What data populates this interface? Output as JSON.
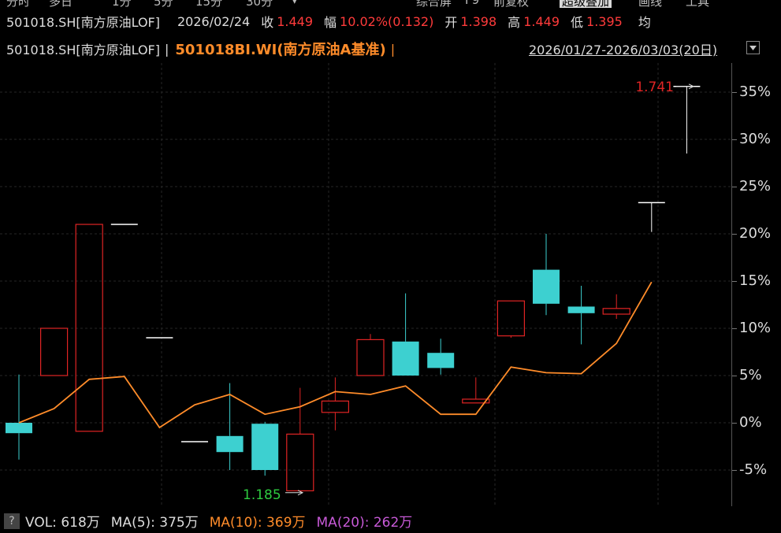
{
  "toolbar": {
    "items": [
      "分时",
      "多日",
      "1分",
      "5分",
      "15分",
      "30分",
      "▾"
    ],
    "right_items": [
      "综合屏",
      "F9",
      "前复权",
      "超级叠加",
      "画线",
      "工具"
    ]
  },
  "quote": {
    "symbol": "501018.SH[南方原油LOF]",
    "date": "2026/02/24",
    "close_label": "收",
    "close_value": "1.449",
    "change_label": "幅",
    "change_value": "10.02%(0.132)",
    "open_label": "开",
    "open_value": "1.398",
    "high_label": "高",
    "high_value": "1.449",
    "low_label": "低",
    "low_value": "1.395",
    "avg_label": "均"
  },
  "overlay": {
    "primary": "501018.SH[南方原油LOF]",
    "separator1": "|",
    "benchmark": "501018BI.WI(南方原油A基准)",
    "separator2": "|",
    "range": "2026/01/27-2026/03/03(20日)"
  },
  "chart_data": {
    "type": "candlestick",
    "y_axis": {
      "unit": "%",
      "ticks": [
        "35%",
        "30%",
        "25%",
        "20%",
        "15%",
        "10%",
        "5%",
        "0%",
        "-5%"
      ],
      "ylim": [
        -9,
        38
      ]
    },
    "annotations": {
      "max_label": "1.741",
      "min_label": "1.185"
    },
    "candles": [
      {
        "o": 0,
        "c": -1.1,
        "h": 5.1,
        "l": -3.9,
        "dir": "down"
      },
      {
        "o": 5.0,
        "c": 10.0,
        "h": 10.0,
        "l": 5.0,
        "dir": "up"
      },
      {
        "o": -0.9,
        "c": 21.0,
        "h": 21.0,
        "l": -0.9,
        "dir": "up"
      },
      {
        "o": 21.0,
        "c": 21.0,
        "h": 21.0,
        "l": 21.0,
        "dir": "flat"
      },
      {
        "o": 9.0,
        "c": 9.0,
        "h": 9.0,
        "l": 9.0,
        "dir": "flat"
      },
      {
        "o": -2.0,
        "c": -2.0,
        "h": -2.0,
        "l": -2.0,
        "dir": "flat"
      },
      {
        "o": -1.4,
        "c": -3.1,
        "h": 4.2,
        "l": -5.0,
        "dir": "down"
      },
      {
        "o": -0.1,
        "c": -5.0,
        "h": 0.1,
        "l": -5.6,
        "dir": "down"
      },
      {
        "o": -7.2,
        "c": -1.2,
        "h": 3.7,
        "l": -7.2,
        "dir": "up"
      },
      {
        "o": 1.1,
        "c": 2.3,
        "h": 4.8,
        "l": -0.8,
        "dir": "up"
      },
      {
        "o": 5.0,
        "c": 8.8,
        "h": 9.4,
        "l": 5.0,
        "dir": "up"
      },
      {
        "o": 8.6,
        "c": 5.0,
        "h": 13.7,
        "l": 5.0,
        "dir": "down"
      },
      {
        "o": 7.4,
        "c": 5.8,
        "h": 8.9,
        "l": 5.1,
        "dir": "down"
      },
      {
        "o": 2.1,
        "c": 2.5,
        "h": 4.8,
        "l": 2.1,
        "dir": "up"
      },
      {
        "o": 9.2,
        "c": 12.9,
        "h": 12.9,
        "l": 9.0,
        "dir": "up"
      },
      {
        "o": 16.2,
        "c": 12.6,
        "h": 20.0,
        "l": 11.4,
        "dir": "down"
      },
      {
        "o": 12.3,
        "c": 11.6,
        "h": 14.5,
        "l": 8.3,
        "dir": "down"
      },
      {
        "o": 11.5,
        "c": 12.1,
        "h": 13.6,
        "l": 11.0,
        "dir": "up"
      },
      {
        "o": 23.3,
        "c": 23.3,
        "h": 23.3,
        "l": 20.2,
        "dir": "flat"
      },
      {
        "o": 35.6,
        "c": 35.6,
        "h": 35.6,
        "l": 28.5,
        "dir": "flat"
      }
    ],
    "benchmark_series": {
      "color": "#ff8c2a",
      "values": [
        0,
        1.5,
        4.6,
        4.9,
        -0.5,
        1.9,
        3.0,
        0.9,
        1.7,
        3.3,
        3.0,
        3.9,
        0.9,
        0.9,
        5.9,
        5.3,
        5.2,
        8.4,
        14.9
      ]
    },
    "colors": {
      "up": "#e02424",
      "down": "#3dd0d0",
      "flat": "#ffffff"
    }
  },
  "indicators": {
    "help": "?",
    "vol": "VOL: 618万",
    "ma5": "MA(5): 375万",
    "ma10": "MA(10): 369万",
    "ma20": "MA(20): 262万"
  }
}
